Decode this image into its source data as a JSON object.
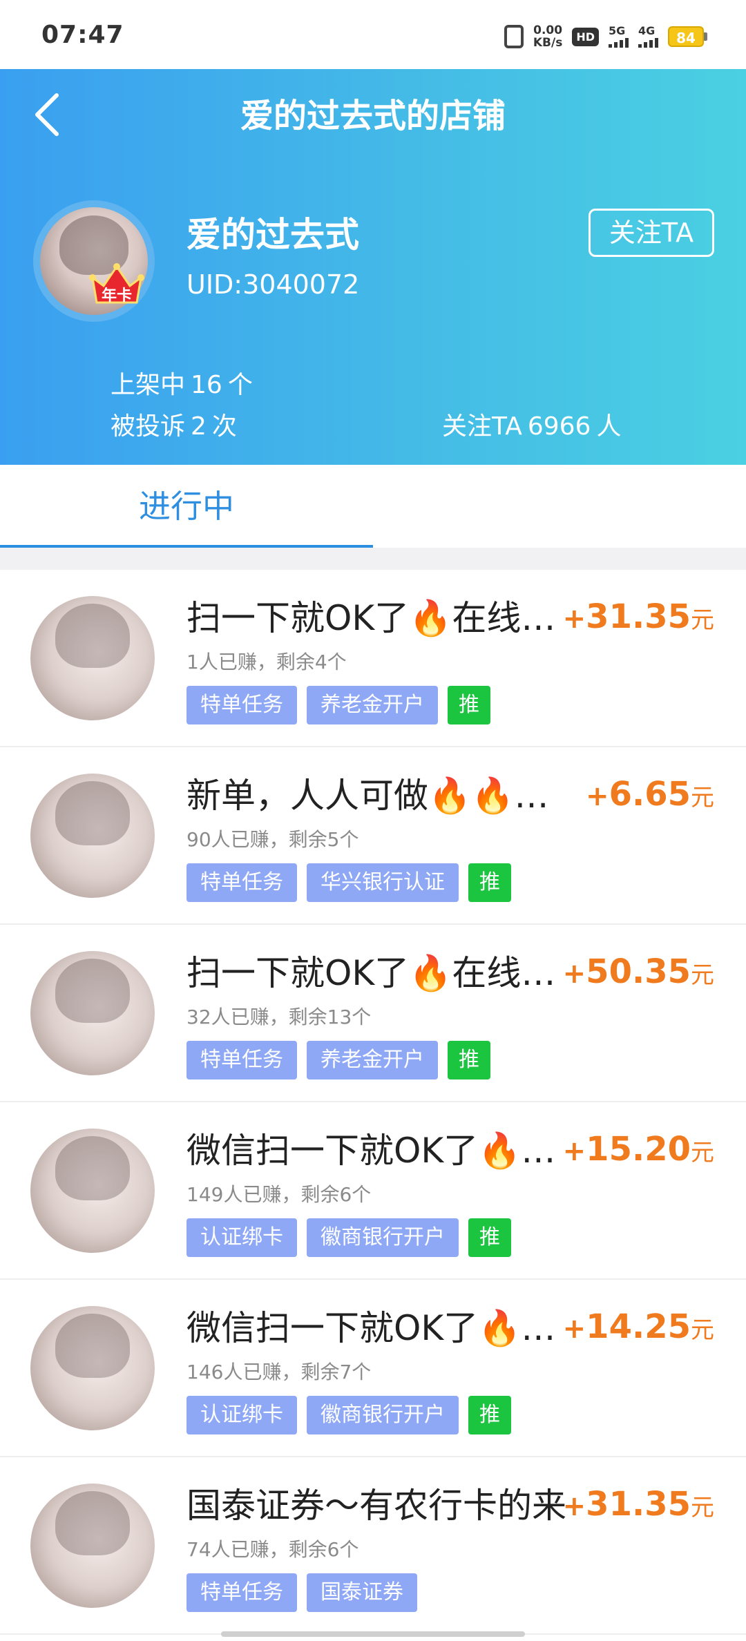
{
  "status_bar": {
    "time": "07:47",
    "net_speed_value": "0.00",
    "net_speed_unit": "KB/s",
    "hd_label": "HD",
    "sig1_label": "5G",
    "sig2_label": "4G",
    "battery": "84"
  },
  "header": {
    "title": "爱的过去式的店铺",
    "username": "爱的过去式",
    "uid": "UID:3040072",
    "badge": "年卡",
    "follow_button": "关注TA",
    "listed_prefix": "上架中",
    "listed_count": "16",
    "listed_suffix": "个",
    "complaints_prefix": "被投诉",
    "complaints_count": "2",
    "complaints_suffix": "次",
    "followers_prefix": "关注TA",
    "followers_count": "6966",
    "followers_suffix": "人"
  },
  "tabs": [
    {
      "label": "进行中",
      "active": true
    }
  ],
  "tasks": [
    {
      "title": "扫一下就OK了🔥在线…",
      "price": "31.35",
      "earned": "1人已赚，剩余4个",
      "tags": [
        "特单任务",
        "养老金开户"
      ],
      "push": "推"
    },
    {
      "title": "新单，人人可做🔥🔥…",
      "price": "6.65",
      "earned": "90人已赚，剩余5个",
      "tags": [
        "特单任务",
        "华兴银行认证"
      ],
      "push": "推"
    },
    {
      "title": "扫一下就OK了🔥在线…",
      "price": "50.35",
      "earned": "32人已赚，剩余13个",
      "tags": [
        "特单任务",
        "养老金开户"
      ],
      "push": "推"
    },
    {
      "title": "微信扫一下就OK了🔥…",
      "price": "15.20",
      "earned": "149人已赚，剩余6个",
      "tags": [
        "认证绑卡",
        "徽商银行开户"
      ],
      "push": "推"
    },
    {
      "title": "微信扫一下就OK了🔥…",
      "price": "14.25",
      "earned": "146人已赚，剩余7个",
      "tags": [
        "认证绑卡",
        "徽商银行开户"
      ],
      "push": "推"
    },
    {
      "title": "国泰证券～有农行卡的来",
      "price": "31.35",
      "earned": "74人已赚，剩余6个",
      "tags": [
        "特单任务",
        "国泰证券"
      ],
      "push": ""
    }
  ],
  "price_plus": "+",
  "price_unit": "元",
  "colors": {
    "accent": "#2e8fe0",
    "price": "#f07a1e",
    "tag": "#8ea8f5",
    "push_tag": "#1bc53f"
  }
}
